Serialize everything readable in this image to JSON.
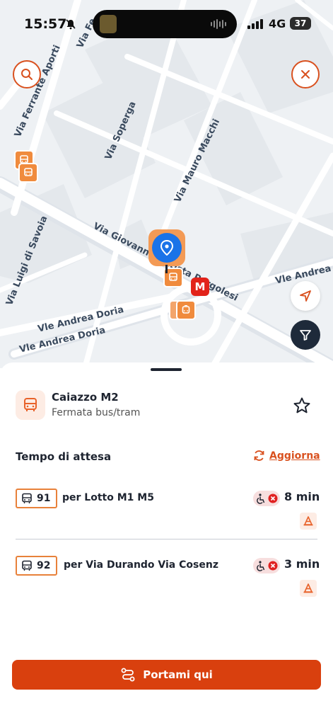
{
  "status_bar": {
    "time": "15:57",
    "network": "4G",
    "battery": "37"
  },
  "map": {
    "streets": [
      "Via Ferrante Aporti",
      "Via Soperga",
      "Via Mauro Macchi",
      "Via Giovanni Battista Pergolesi",
      "Via Luigi di Savoia",
      "Vle Andrea Doria",
      "Vle Andrea Doria",
      "Vle Andrea D",
      "Via Fe"
    ],
    "metro_label": "M",
    "search_icon": "search-icon",
    "close_icon": "close-icon",
    "locate_icon": "navigation-arrow-icon",
    "filter_icon": "filter-icon"
  },
  "stop": {
    "name": "Caiazzo M2",
    "type": "Fermata bus/tram"
  },
  "wait": {
    "label": "Tempo di attesa",
    "refresh_label": "Aggiorna"
  },
  "departures": [
    {
      "line": "91",
      "destination": "per Lotto M1 M5",
      "minutes": "8 min"
    },
    {
      "line": "92",
      "destination": "per Via Durando Via Cosenz",
      "minutes": "3 min"
    }
  ],
  "cta": {
    "label": "Portami qui"
  },
  "colors": {
    "accent": "#d9400e",
    "badge_border": "#e8813a",
    "pin": "#1a73e8",
    "metro": "#e2231a"
  }
}
